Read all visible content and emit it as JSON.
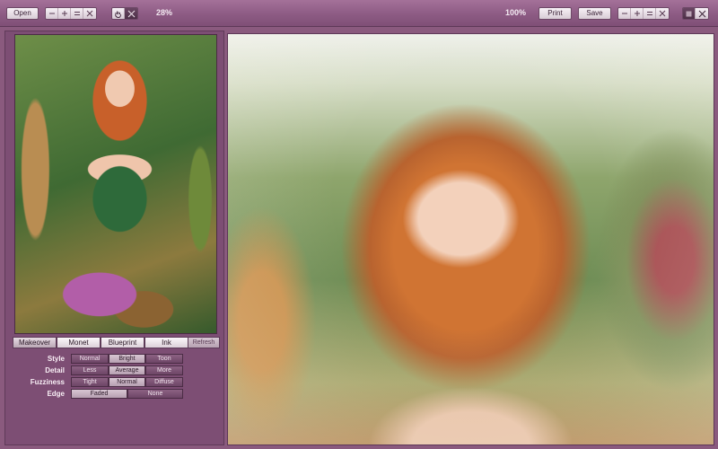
{
  "toolbar": {
    "open_label": "Open",
    "left_zoom": "28%",
    "right_zoom": "100%",
    "print_label": "Print",
    "save_label": "Save",
    "zoom_icons": [
      "zoom-out-icon",
      "zoom-in-icon",
      "fit-icon",
      "actual-size-icon"
    ],
    "tool_icons": [
      "hand-icon",
      "crop-icon"
    ]
  },
  "left_panel": {
    "image_description_icon": "photo-thumbnail",
    "tabs": [
      "Makeover",
      "Monet",
      "Blueprint",
      "Ink"
    ],
    "selected_tab": "Makeover",
    "refresh_label": "Refresh",
    "options": [
      {
        "label": "Style",
        "choices": [
          "Normal",
          "Bright",
          "Toon"
        ],
        "selected": "Bright"
      },
      {
        "label": "Detail",
        "choices": [
          "Less",
          "Average",
          "More"
        ],
        "selected": "Average"
      },
      {
        "label": "Fuzziness",
        "choices": [
          "Tight",
          "Normal",
          "Diffuse"
        ],
        "selected": "Normal"
      },
      {
        "label": "Edge",
        "choices": [
          "Faded",
          "None"
        ],
        "selected": "Faded"
      }
    ]
  },
  "colors": {
    "panel": "#7d4e74",
    "toolbar": "#8d5b84",
    "accent": "#d9c7d4"
  }
}
